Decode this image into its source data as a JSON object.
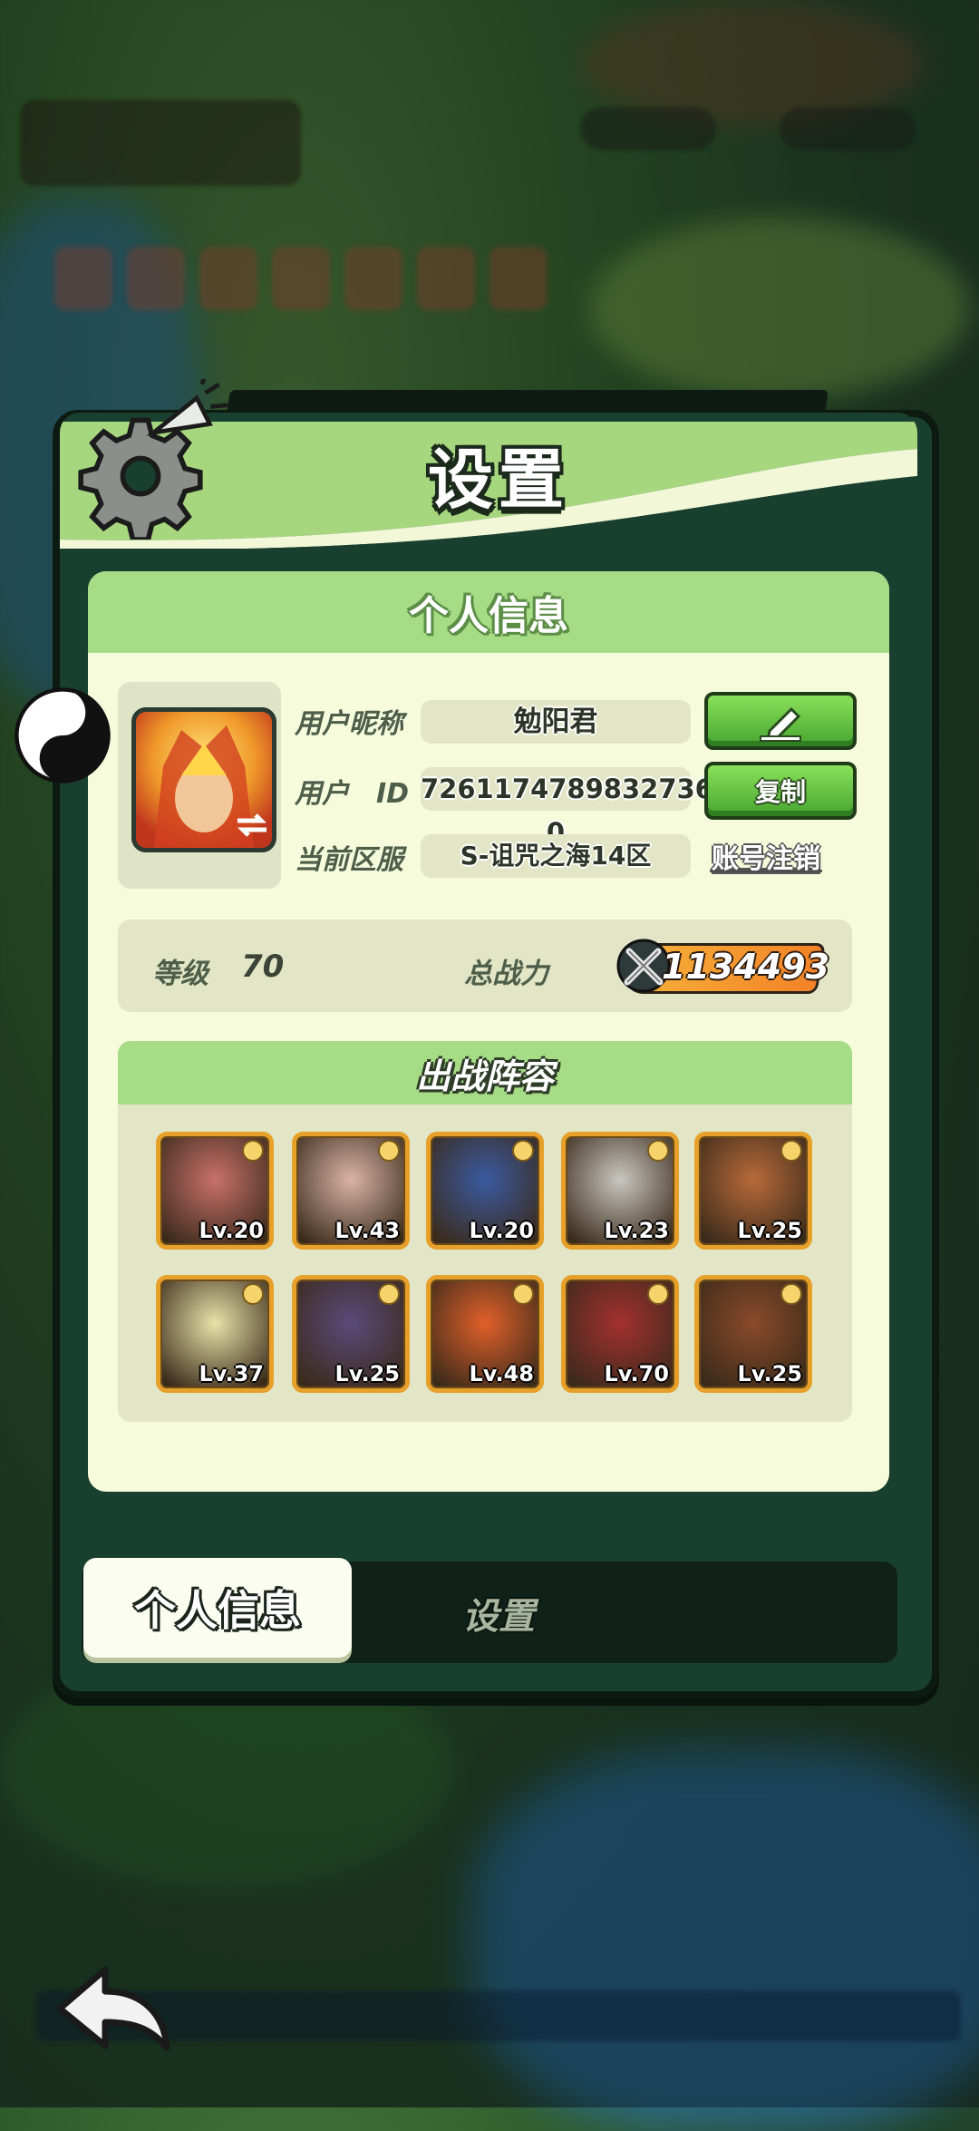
{
  "panel": {
    "title": "设置"
  },
  "profile": {
    "section_title": "个人信息",
    "nickname_label": "用户昵称",
    "nickname": "勉阳君",
    "id_label": "用户　ID",
    "user_id": "7261174789832736​0",
    "server_label": "当前区服",
    "server": "S-诅咒之海14区",
    "copy_label": "复制",
    "deregister_label": "账号注销"
  },
  "stats": {
    "level_label": "等级",
    "level": "70",
    "power_label": "总战力",
    "power": "1134493"
  },
  "lineup": {
    "title": "出战阵容",
    "heroes": [
      {
        "level": "Lv.20",
        "color": "#c8706a"
      },
      {
        "level": "Lv.43",
        "color": "#d9b4a6"
      },
      {
        "level": "Lv.20",
        "color": "#3a5aa0"
      },
      {
        "level": "Lv.23",
        "color": "#c9c7c0"
      },
      {
        "level": "Lv.25",
        "color": "#b86a3a"
      },
      {
        "level": "Lv.37",
        "color": "#e8e2a8"
      },
      {
        "level": "Lv.25",
        "color": "#5a4a7a"
      },
      {
        "level": "Lv.48",
        "color": "#e0602a"
      },
      {
        "level": "Lv.70",
        "color": "#a33030"
      },
      {
        "level": "Lv.25",
        "color": "#8a4a2a"
      }
    ]
  },
  "tabs": {
    "active": "个人信息",
    "inactive": "设置"
  },
  "icons": [
    "gear-icon",
    "megaphone-icon",
    "edit-pencil-icon",
    "swap-arrow-icon",
    "crossed-swords-icon",
    "yin-yang-icon",
    "back-arrow-icon"
  ]
}
